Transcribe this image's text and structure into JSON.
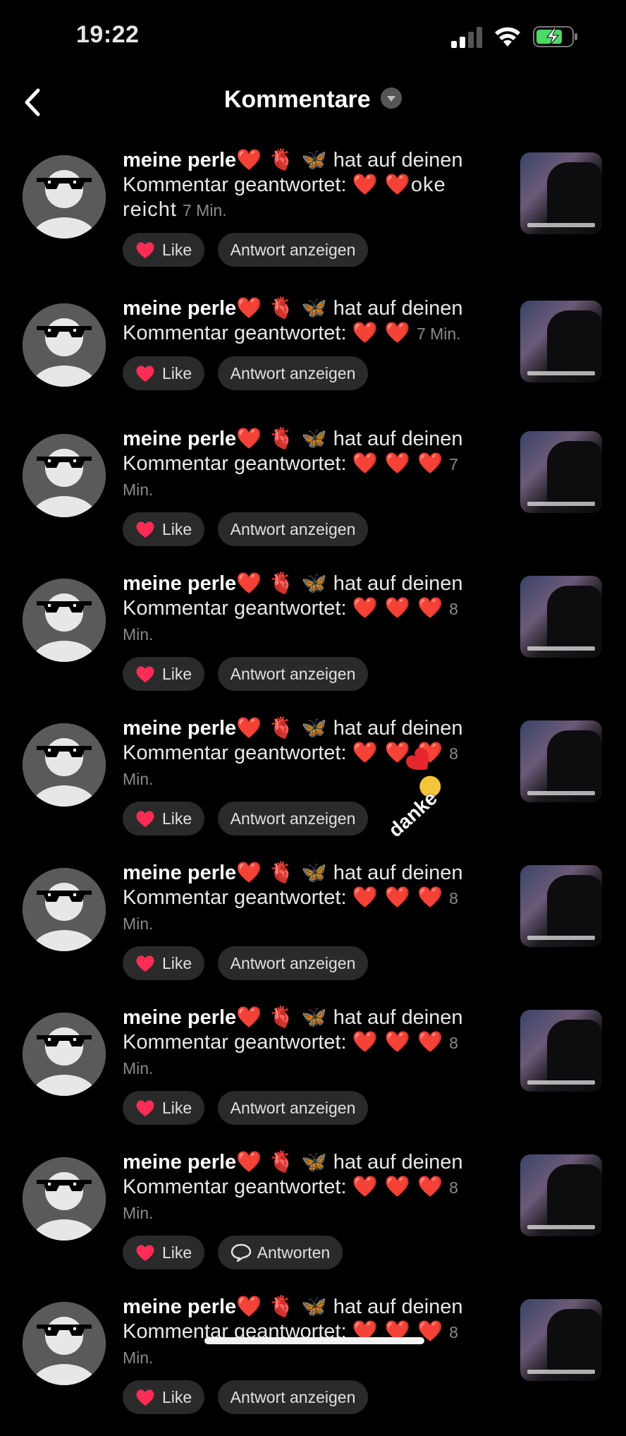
{
  "status_bar": {
    "time": "19:22"
  },
  "header": {
    "title": "Kommentare"
  },
  "colors": {
    "heart": "#ff2d55",
    "background": "#000000",
    "pill": "#2a2a2a"
  },
  "comments": [
    {
      "name": "meine perle",
      "name_emoji": "❤️ 🫀 🦋",
      "text": "hat auf deinen Kommentar geantwortet:",
      "reply": "❤️ ❤️oke reicht",
      "time": "7 Min.",
      "like_label": "Like",
      "action_label": "Antwort anzeigen"
    },
    {
      "name": "meine perle",
      "name_emoji": "❤️ 🫀 🦋",
      "text": "hat auf deinen Kommentar geantwortet:",
      "reply": "❤️ ❤️",
      "time": "7 Min.",
      "like_label": "Like",
      "action_label": "Antwort anzeigen"
    },
    {
      "name": "meine perle",
      "name_emoji": "❤️ 🫀 🦋",
      "text": "hat auf deinen Kommentar geantwortet:",
      "reply": "❤️ ❤️ ❤️",
      "time": "7 Min.",
      "like_label": "Like",
      "action_label": "Antwort anzeigen"
    },
    {
      "name": "meine perle",
      "name_emoji": "❤️ 🫀 🦋",
      "text": "hat auf deinen Kommentar geantwortet:",
      "reply": "❤️ ❤️ ❤️",
      "time": "8 Min.",
      "like_label": "Like",
      "action_label": "Antwort anzeigen"
    },
    {
      "name": "meine perle",
      "name_emoji": "❤️ 🫀 🦋",
      "text": "hat auf deinen Kommentar geantwortet:",
      "reply": "❤️ ❤️ ❤️",
      "time": "8 Min.",
      "like_label": "Like",
      "action_label": "Antwort anzeigen"
    },
    {
      "name": "meine perle",
      "name_emoji": "❤️ 🫀 🦋",
      "text": "hat auf deinen Kommentar geantwortet:",
      "reply": "❤️ ❤️ ❤️",
      "time": "8 Min.",
      "like_label": "Like",
      "action_label": "Antwort anzeigen"
    },
    {
      "name": "meine perle",
      "name_emoji": "❤️ 🫀 🦋",
      "text": "hat auf deinen Kommentar geantwortet:",
      "reply": "❤️ ❤️ ❤️",
      "time": "8 Min.",
      "like_label": "Like",
      "action_label": "Antwort anzeigen"
    },
    {
      "name": "meine perle",
      "name_emoji": "❤️ 🫀 🦋",
      "text": "hat auf deinen Kommentar geantwortet:",
      "reply": "❤️ ❤️ ❤️",
      "time": "8 Min.",
      "like_label": "Like",
      "action_label": "Antworten"
    },
    {
      "name": "meine perle",
      "name_emoji": "❤️ 🫀 🦋",
      "text": "hat auf deinen Kommentar geantwortet:",
      "reply": "❤️ ❤️ ❤️",
      "time": "8 Min.",
      "like_label": "Like",
      "action_label": "Antwort anzeigen"
    }
  ],
  "sticker": {
    "text": "danke"
  }
}
